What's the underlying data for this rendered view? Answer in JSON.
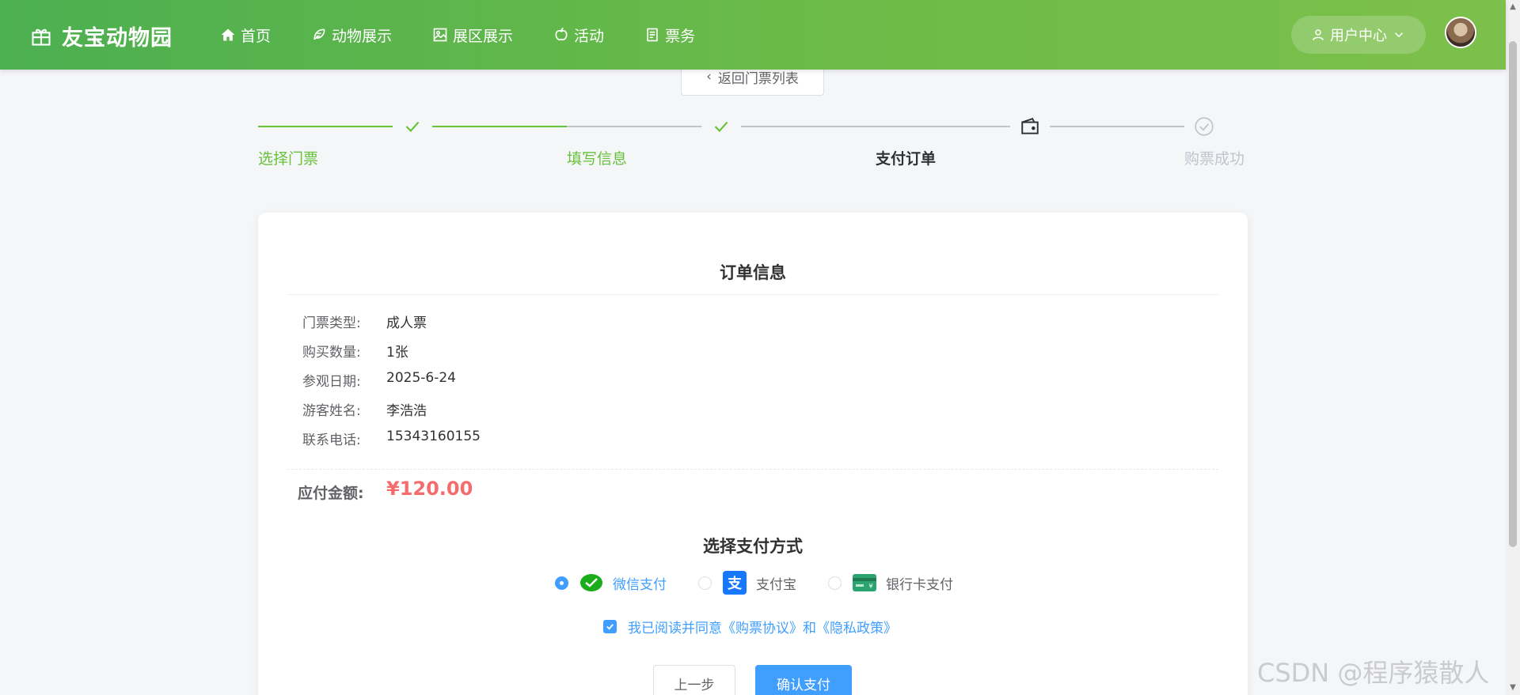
{
  "header": {
    "logo_text": "友宝动物园",
    "nav": [
      {
        "label": "首页",
        "icon": "home-icon"
      },
      {
        "label": "动物展示",
        "icon": "feather-icon"
      },
      {
        "label": "展区展示",
        "icon": "image-icon"
      },
      {
        "label": "活动",
        "icon": "apple-icon"
      },
      {
        "label": "票务",
        "icon": "document-icon"
      }
    ],
    "user_center_label": "用户中心"
  },
  "back_button_label": "返回门票列表",
  "steps": [
    {
      "label": "选择门票",
      "status": "finished"
    },
    {
      "label": "填写信息",
      "status": "finished"
    },
    {
      "label": "支付订单",
      "status": "process"
    },
    {
      "label": "购票成功",
      "status": "wait"
    }
  ],
  "order": {
    "title": "订单信息",
    "rows": [
      {
        "label": "门票类型:",
        "value": "成人票"
      },
      {
        "label": "购买数量:",
        "value": "1张"
      },
      {
        "label": "参观日期:",
        "value": "2025-6-24"
      },
      {
        "label": "游客姓名:",
        "value": "李浩浩"
      },
      {
        "label": "联系电话:",
        "value": "15343160155"
      }
    ],
    "amount_label": "应付金额:",
    "amount_value": "¥120.00"
  },
  "payment": {
    "title": "选择支付方式",
    "options": [
      {
        "label": "微信支付",
        "selected": true,
        "icon": "wechat-pay-icon"
      },
      {
        "label": "支付宝",
        "selected": false,
        "icon": "alipay-icon"
      },
      {
        "label": "银行卡支付",
        "selected": false,
        "icon": "bank-card-icon"
      }
    ],
    "agreement_text": "我已阅读并同意《购票协议》和《隐私政策》",
    "agreement_checked": true,
    "prev_label": "上一步",
    "confirm_label": "确认支付"
  },
  "watermark": "CSDN @程序猿散人",
  "colors": {
    "header_green": "#5db64a",
    "step_finished": "#67c23a",
    "primary": "#409eff",
    "price": "#f56c6c"
  }
}
